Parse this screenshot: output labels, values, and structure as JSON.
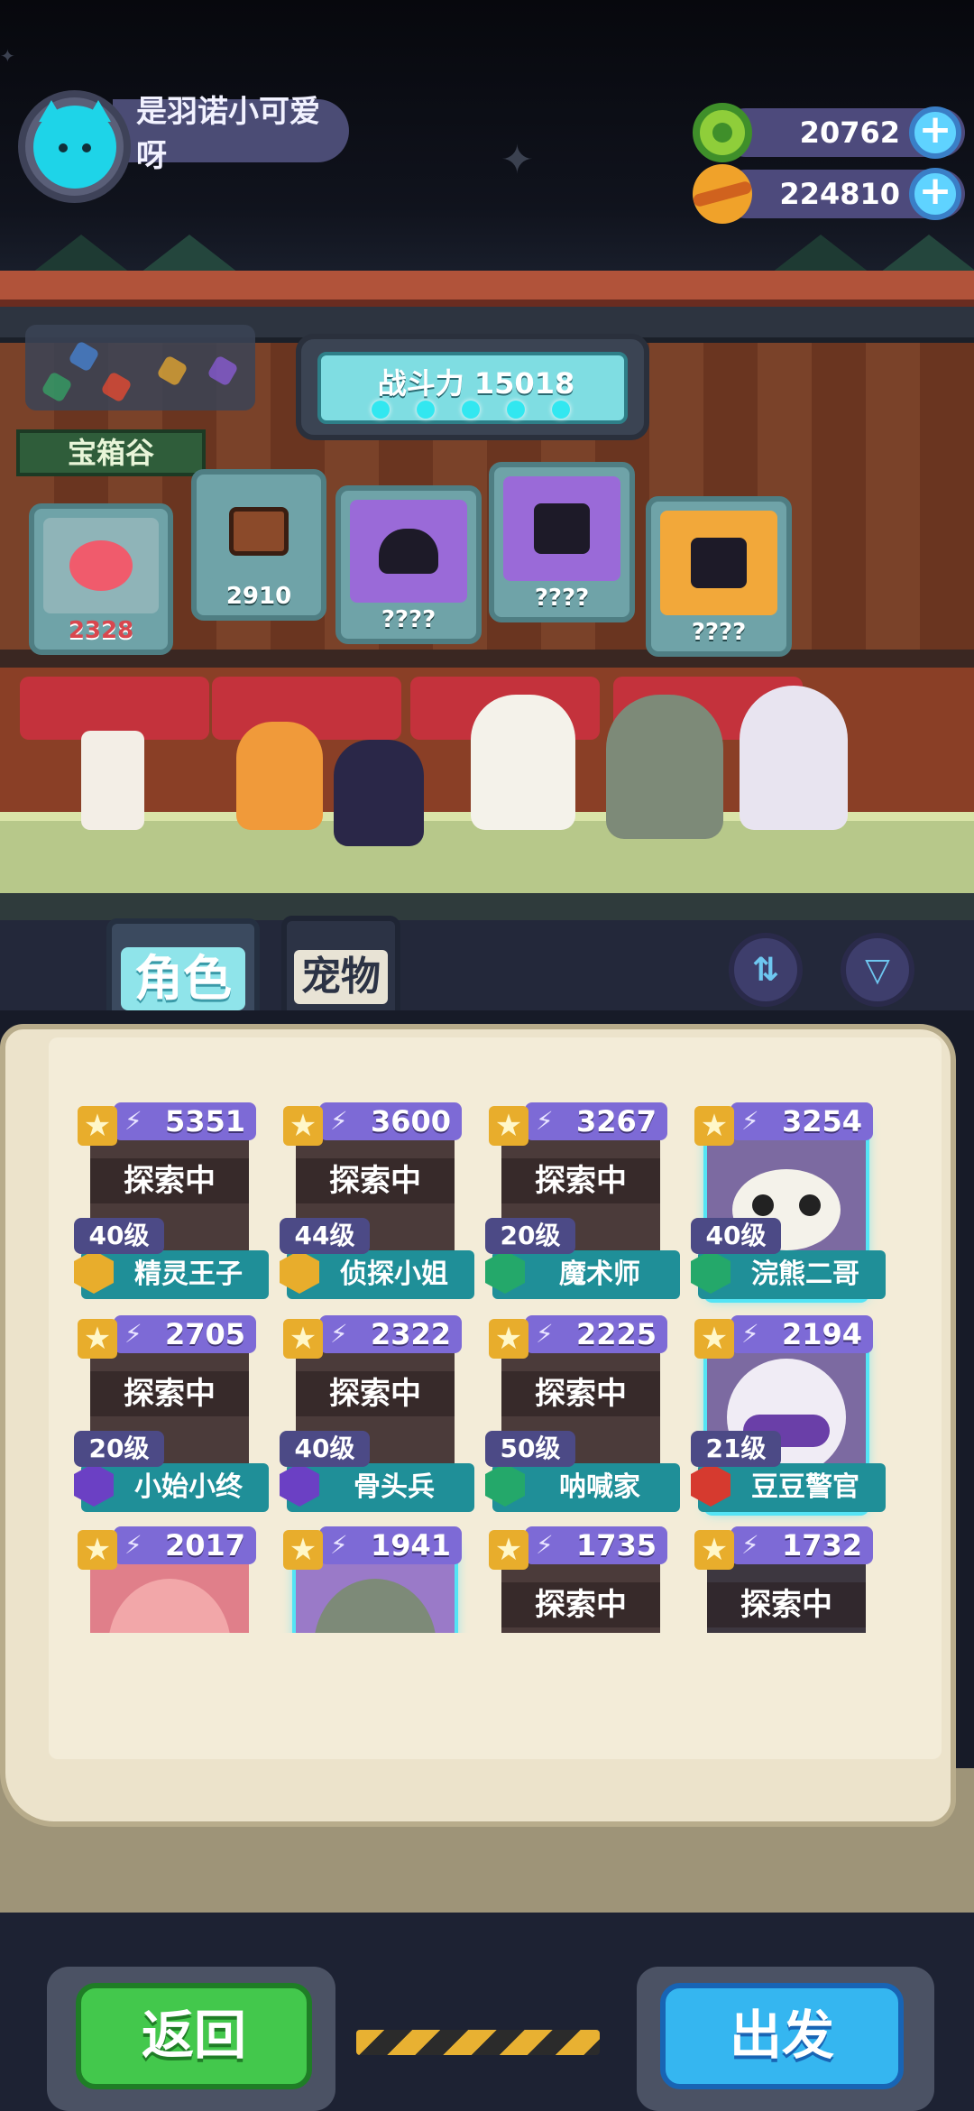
{
  "player": {
    "name": "是羽诺小可爱呀",
    "avatar_icon": "cat-avatar-icon"
  },
  "currencies": [
    {
      "name": "green-gem",
      "icon": "green-donut-icon",
      "value": "20762"
    },
    {
      "name": "planet-coin",
      "icon": "orange-planet-icon",
      "value": "224810"
    }
  ],
  "stage": {
    "power_label": "战斗力 15018",
    "region": "宝箱谷",
    "chests": [
      {
        "value": "2328",
        "color": "#d9474e"
      },
      {
        "value": "2910",
        "color": "#ffffff"
      },
      {
        "value": "????",
        "color": "#ffffff"
      },
      {
        "value": "????",
        "color": "#ffffff"
      },
      {
        "value": "????",
        "color": "#ffffff"
      }
    ]
  },
  "tabs": {
    "role": "角色",
    "pet": "宠物"
  },
  "roster": [
    {
      "power": "5351",
      "status": "探索中",
      "level": "40级",
      "name": "精灵王子",
      "faction": "gold"
    },
    {
      "power": "3600",
      "status": "探索中",
      "level": "44级",
      "name": "侦探小姐",
      "faction": "gold"
    },
    {
      "power": "3267",
      "status": "探索中",
      "level": "20级",
      "name": "魔术师",
      "faction": "green"
    },
    {
      "power": "3254",
      "status": "",
      "level": "40级",
      "name": "浣熊二哥",
      "faction": "green"
    },
    {
      "power": "2705",
      "status": "探索中",
      "level": "20级",
      "name": "小始小终",
      "faction": "purple"
    },
    {
      "power": "2322",
      "status": "探索中",
      "level": "40级",
      "name": "骨头兵",
      "faction": "purple"
    },
    {
      "power": "2225",
      "status": "探索中",
      "level": "50级",
      "name": "呐喊家",
      "faction": "green"
    },
    {
      "power": "2194",
      "status": "",
      "level": "21级",
      "name": "豆豆警官",
      "faction": "red"
    },
    {
      "power": "2017",
      "status": "",
      "level": "",
      "name": "",
      "faction": ""
    },
    {
      "power": "1941",
      "status": "",
      "level": "",
      "name": "",
      "faction": ""
    },
    {
      "power": "1735",
      "status": "探索中",
      "level": "",
      "name": "",
      "faction": ""
    },
    {
      "power": "1732",
      "status": "探索中",
      "level": "",
      "name": "",
      "faction": ""
    }
  ],
  "buttons": {
    "back": "返回",
    "go": "出发"
  }
}
